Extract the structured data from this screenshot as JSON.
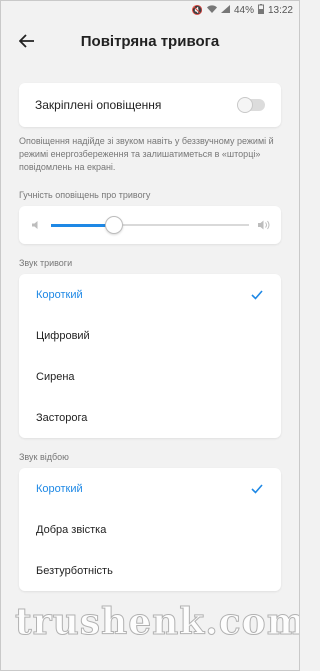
{
  "status_bar": {
    "battery": "44%",
    "time": "13:22"
  },
  "header": {
    "title": "Повітряна тривога",
    "back_icon": "arrow-left-icon"
  },
  "pinned": {
    "label": "Закріплені оповіщення",
    "enabled": false
  },
  "hint": "Оповіщення надійде зі звуком навіть у беззвучному режимі й режимі енергозбереження та залишатиметься в «шторці» повідомлень на екрані.",
  "volume": {
    "label": "Гучність оповіщень про тривогу",
    "level": 0.32
  },
  "alarm_sound": {
    "label": "Звук тривоги",
    "options": [
      "Короткий",
      "Цифровий",
      "Сирена",
      "Засторога"
    ],
    "selected": "Короткий"
  },
  "clear_sound": {
    "label": "Звук відбою",
    "options": [
      "Короткий",
      "Добра звістка",
      "Безтурботність"
    ],
    "selected": "Короткий"
  },
  "colors": {
    "accent": "#1e88e5",
    "background": "#f2f2f2"
  },
  "watermark": "trushenk.com"
}
